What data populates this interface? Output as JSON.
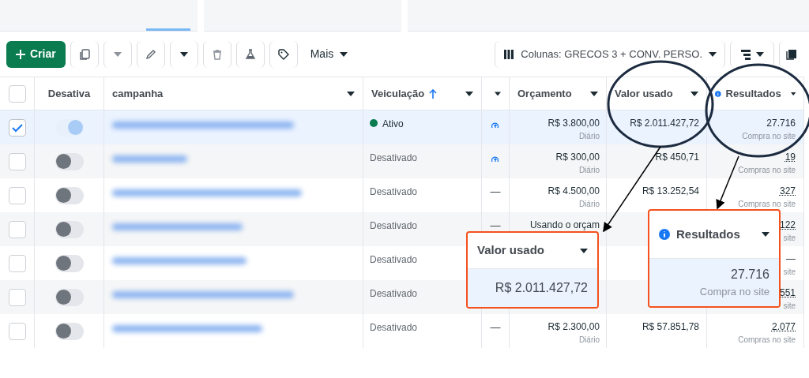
{
  "toolbar": {
    "create_button": "Criar",
    "more_button": "Mais",
    "columns_button": "Colunas: GRECOS 3 + CONV. PERSO."
  },
  "table": {
    "columns": [
      {
        "kind": "check",
        "checked": false
      },
      {
        "kind": "text",
        "label": "Desativa"
      },
      {
        "kind": "menu",
        "label": "campanha"
      },
      {
        "kind": "menu",
        "label": "Veiculação",
        "sorted": true
      },
      {
        "kind": "menu"
      },
      {
        "kind": "menu",
        "label": "Orçamento"
      },
      {
        "kind": "menu",
        "label": "Valor usado"
      },
      {
        "kind": "menu",
        "label": "Resultados",
        "info": true
      }
    ],
    "rows": [
      {
        "selected": true,
        "on": true,
        "status": "Ativo",
        "active": true,
        "learning": true,
        "budget": "R$ 3.800,00",
        "budget_period": "Diário",
        "spent": "R$ 2.011.427,72",
        "result": "27.716",
        "result_label": "Compra no site",
        "linked": false
      },
      {
        "selected": false,
        "on": false,
        "status": "Desativado",
        "active": false,
        "learning": true,
        "budget": "R$ 300,00",
        "budget_period": "Diário",
        "spent": "R$ 450,71",
        "result": "19",
        "result_label": "Compras no site",
        "linked": true
      },
      {
        "selected": false,
        "on": false,
        "status": "Desativado",
        "active": false,
        "learning": false,
        "extra": "—",
        "budget": "R$ 4.500,00",
        "budget_period": "Diário",
        "spent": "R$ 13.252,54",
        "result": "327",
        "result_label": "Compras no site",
        "linked": true
      },
      {
        "selected": false,
        "on": false,
        "status": "Desativado",
        "active": false,
        "learning": false,
        "extra": "—",
        "budget": "Usando o orçam",
        "result": "122",
        "result_label": "site",
        "linked": true
      },
      {
        "selected": false,
        "on": false,
        "status": "Desativado",
        "active": false,
        "result": "—",
        "result_label": "site",
        "linked": false
      },
      {
        "selected": false,
        "on": false,
        "status": "Desativado",
        "active": false,
        "result": "551",
        "result_label": "site",
        "linked": true
      },
      {
        "selected": false,
        "on": false,
        "status": "Desativado",
        "active": false,
        "learning": false,
        "extra": "—",
        "budget": "R$ 2.300,00",
        "budget_period": "Diário",
        "spent": "R$ 57.851,78",
        "result": "2.077",
        "result_label": "Compras no site",
        "linked": true
      }
    ]
  },
  "callouts": [
    {
      "title": "Valor usado",
      "value": "R$ 2.011.427,72"
    },
    {
      "title": "Resultados",
      "info": true,
      "value": "27.716",
      "label": "Compra no site"
    }
  ]
}
